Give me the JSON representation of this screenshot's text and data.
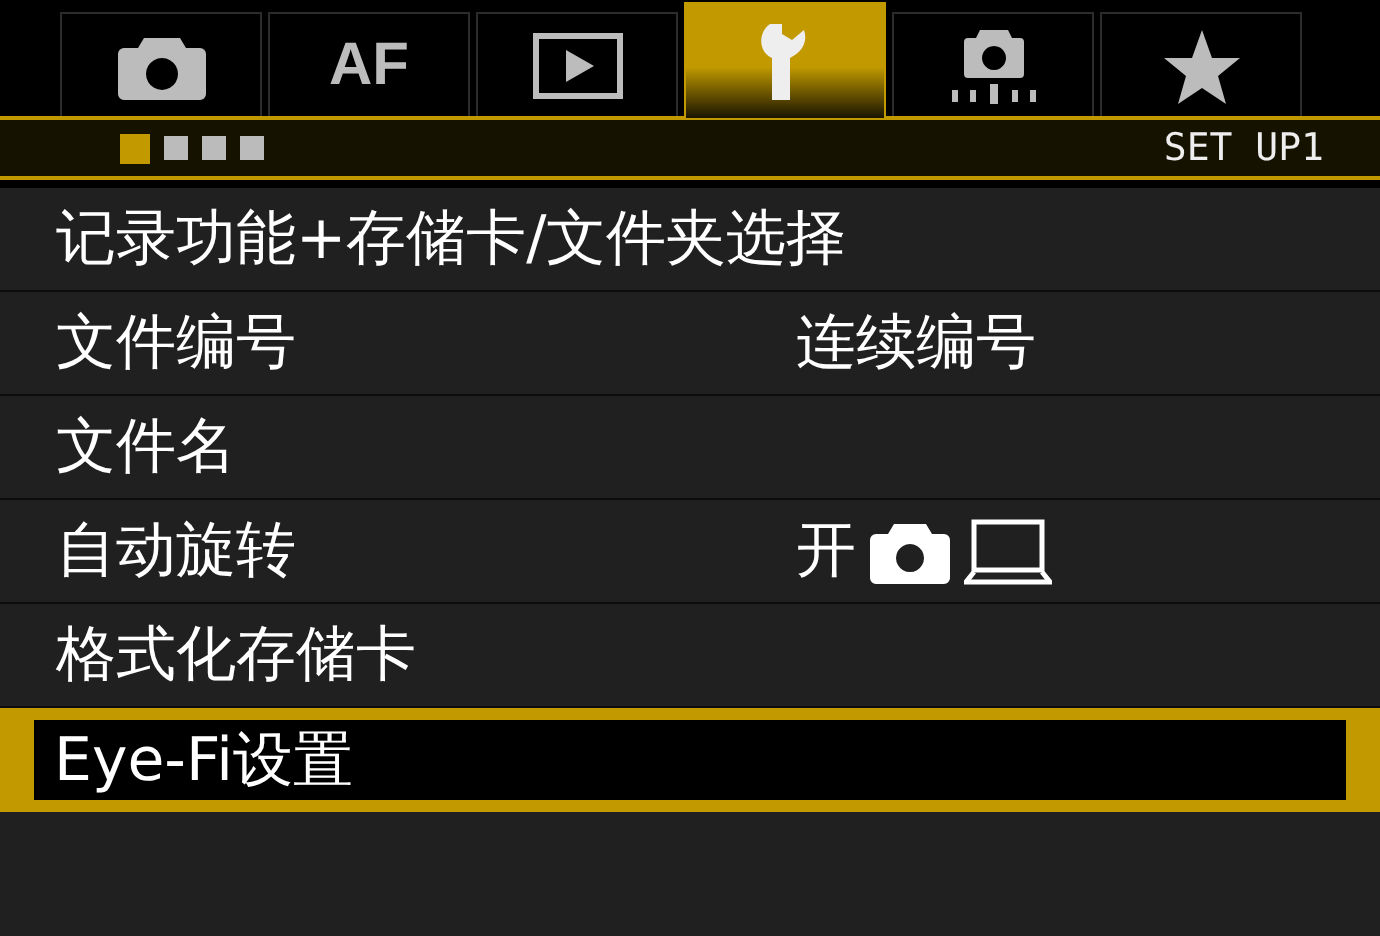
{
  "tabs": [
    {
      "kind": "camera",
      "selected": false
    },
    {
      "kind": "text",
      "label": "AF",
      "selected": false
    },
    {
      "kind": "playback",
      "selected": false
    },
    {
      "kind": "wrench",
      "selected": true
    },
    {
      "kind": "camera-dots",
      "selected": false
    },
    {
      "kind": "star",
      "selected": false
    }
  ],
  "pages": [
    {
      "selected": true
    },
    {
      "selected": false
    },
    {
      "selected": false
    },
    {
      "selected": false
    }
  ],
  "page_title": "SET UP1",
  "items": [
    {
      "label": "记录功能+存储卡/文件夹选择",
      "selected": false
    },
    {
      "label": "文件编号",
      "value": "连续编号",
      "selected": false
    },
    {
      "label": "文件名",
      "selected": false
    },
    {
      "label": "自动旋转",
      "value": "开",
      "kind": "on-icons",
      "selected": false
    },
    {
      "label": "格式化存储卡",
      "selected": false
    },
    {
      "label": "Eye-Fi设置",
      "selected": true
    }
  ]
}
